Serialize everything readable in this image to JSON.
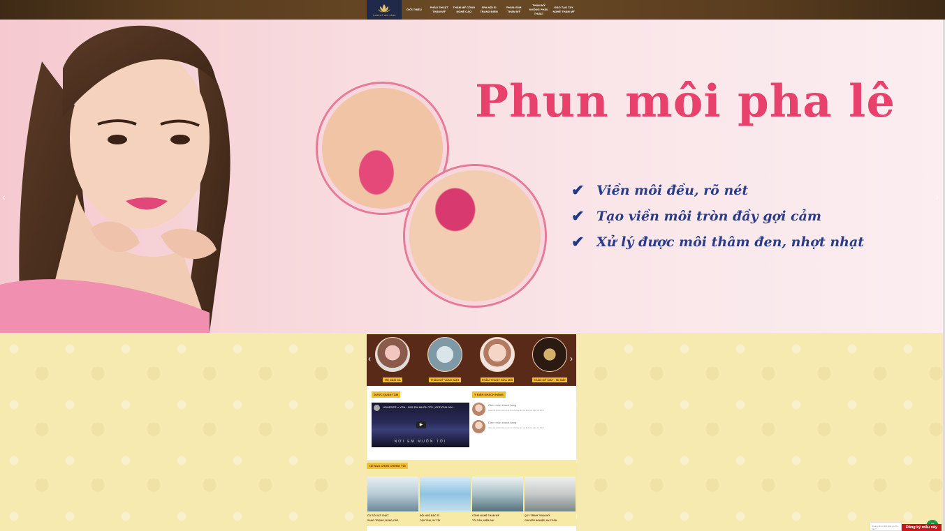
{
  "nav": {
    "logo_text": "THẨM MỸ SEN VÀNG",
    "items": [
      {
        "label": "GIỚI THIỆU"
      },
      {
        "label": "PHẪU THUẬT THẨM MỸ"
      },
      {
        "label": "THẨM MỸ CÔNG NGHỆ CAO"
      },
      {
        "label": "SPA NỘI SI TRANG ĐIỂM"
      },
      {
        "label": "PHUN XĂM THẨM MỸ"
      },
      {
        "label": "THẨM MỸ KHÔNG PHẪU THUẬT"
      },
      {
        "label": "ĐÀO TẠO TAY NGHỀ THẨM MỸ"
      }
    ]
  },
  "hero": {
    "title": "Phun môi pha lê",
    "benefits": [
      "Viền môi đều, rõ nét",
      "Tạo viền môi tròn đầy gợi cảm",
      "Xử lý được môi thâm đen, nhợt nhạt"
    ],
    "prev_arrow": "‹",
    "next_arrow": "›"
  },
  "services": {
    "items": [
      {
        "label": "TRỊ NÁM DA"
      },
      {
        "label": "THẨM MỸ VÙNG MẶT"
      },
      {
        "label": "PHẪU THUẬT SỬA MŨI"
      },
      {
        "label": "THẨM MỸ MẮT - MI MẮT"
      }
    ],
    "prev": "‹",
    "next": "›"
  },
  "featured": {
    "badge": "ĐƯỢC QUAN TÂM",
    "video_title": "HOUPROF x YEN - NƠI EM MUỐN TỚI | OFFICIAL MV...",
    "video_text": "NƠI EM MUỐN TỚI",
    "play": "▶"
  },
  "reviews": {
    "badge": "Ý KIẾN KHÁCH HÀNG",
    "items": [
      {
        "name": "Cảm nhận khách hàng",
        "text": "Câu nói ai là một sự tự tin nhưng ăn nói luôn là việc ổn định"
      },
      {
        "name": "Cảm nhận khách hàng",
        "text": "Câu nói ai là một sự tự tin nhưng ăn nói luôn là việc ổn định"
      }
    ]
  },
  "why": {
    "badge": "TẠI SAO CHỌN CHÚNG TÔI",
    "cards": [
      {
        "line1": "CƠ SỞ VẬT CHẤT",
        "line2": "SANG TRỌNG, ĐẲNG CẤP"
      },
      {
        "line1": "ĐỘI NGŨ BÁC SĨ",
        "line2": "TẬN TÂM, UY TÍN"
      },
      {
        "line1": "CÔNG NGHỆ THẨM MỸ",
        "line2": "TỐI TÂN, HIỆN ĐẠI"
      },
      {
        "line1": "QUY TRÌNH THẨM MỸ",
        "line2": "CHUYÊN NGHIỆP, AN TOÀN"
      }
    ]
  },
  "widgets": {
    "chat_text": "Chúng tôi có thể giúp gì cho bạn?",
    "chat_icon": "✆",
    "register": "Đăng ký mẫu này"
  },
  "colors": {
    "brand_gold": "#f2c02f",
    "hero_title": "#e8416c",
    "benefit_text": "#2a3c8a",
    "register_red": "#c8161d"
  }
}
